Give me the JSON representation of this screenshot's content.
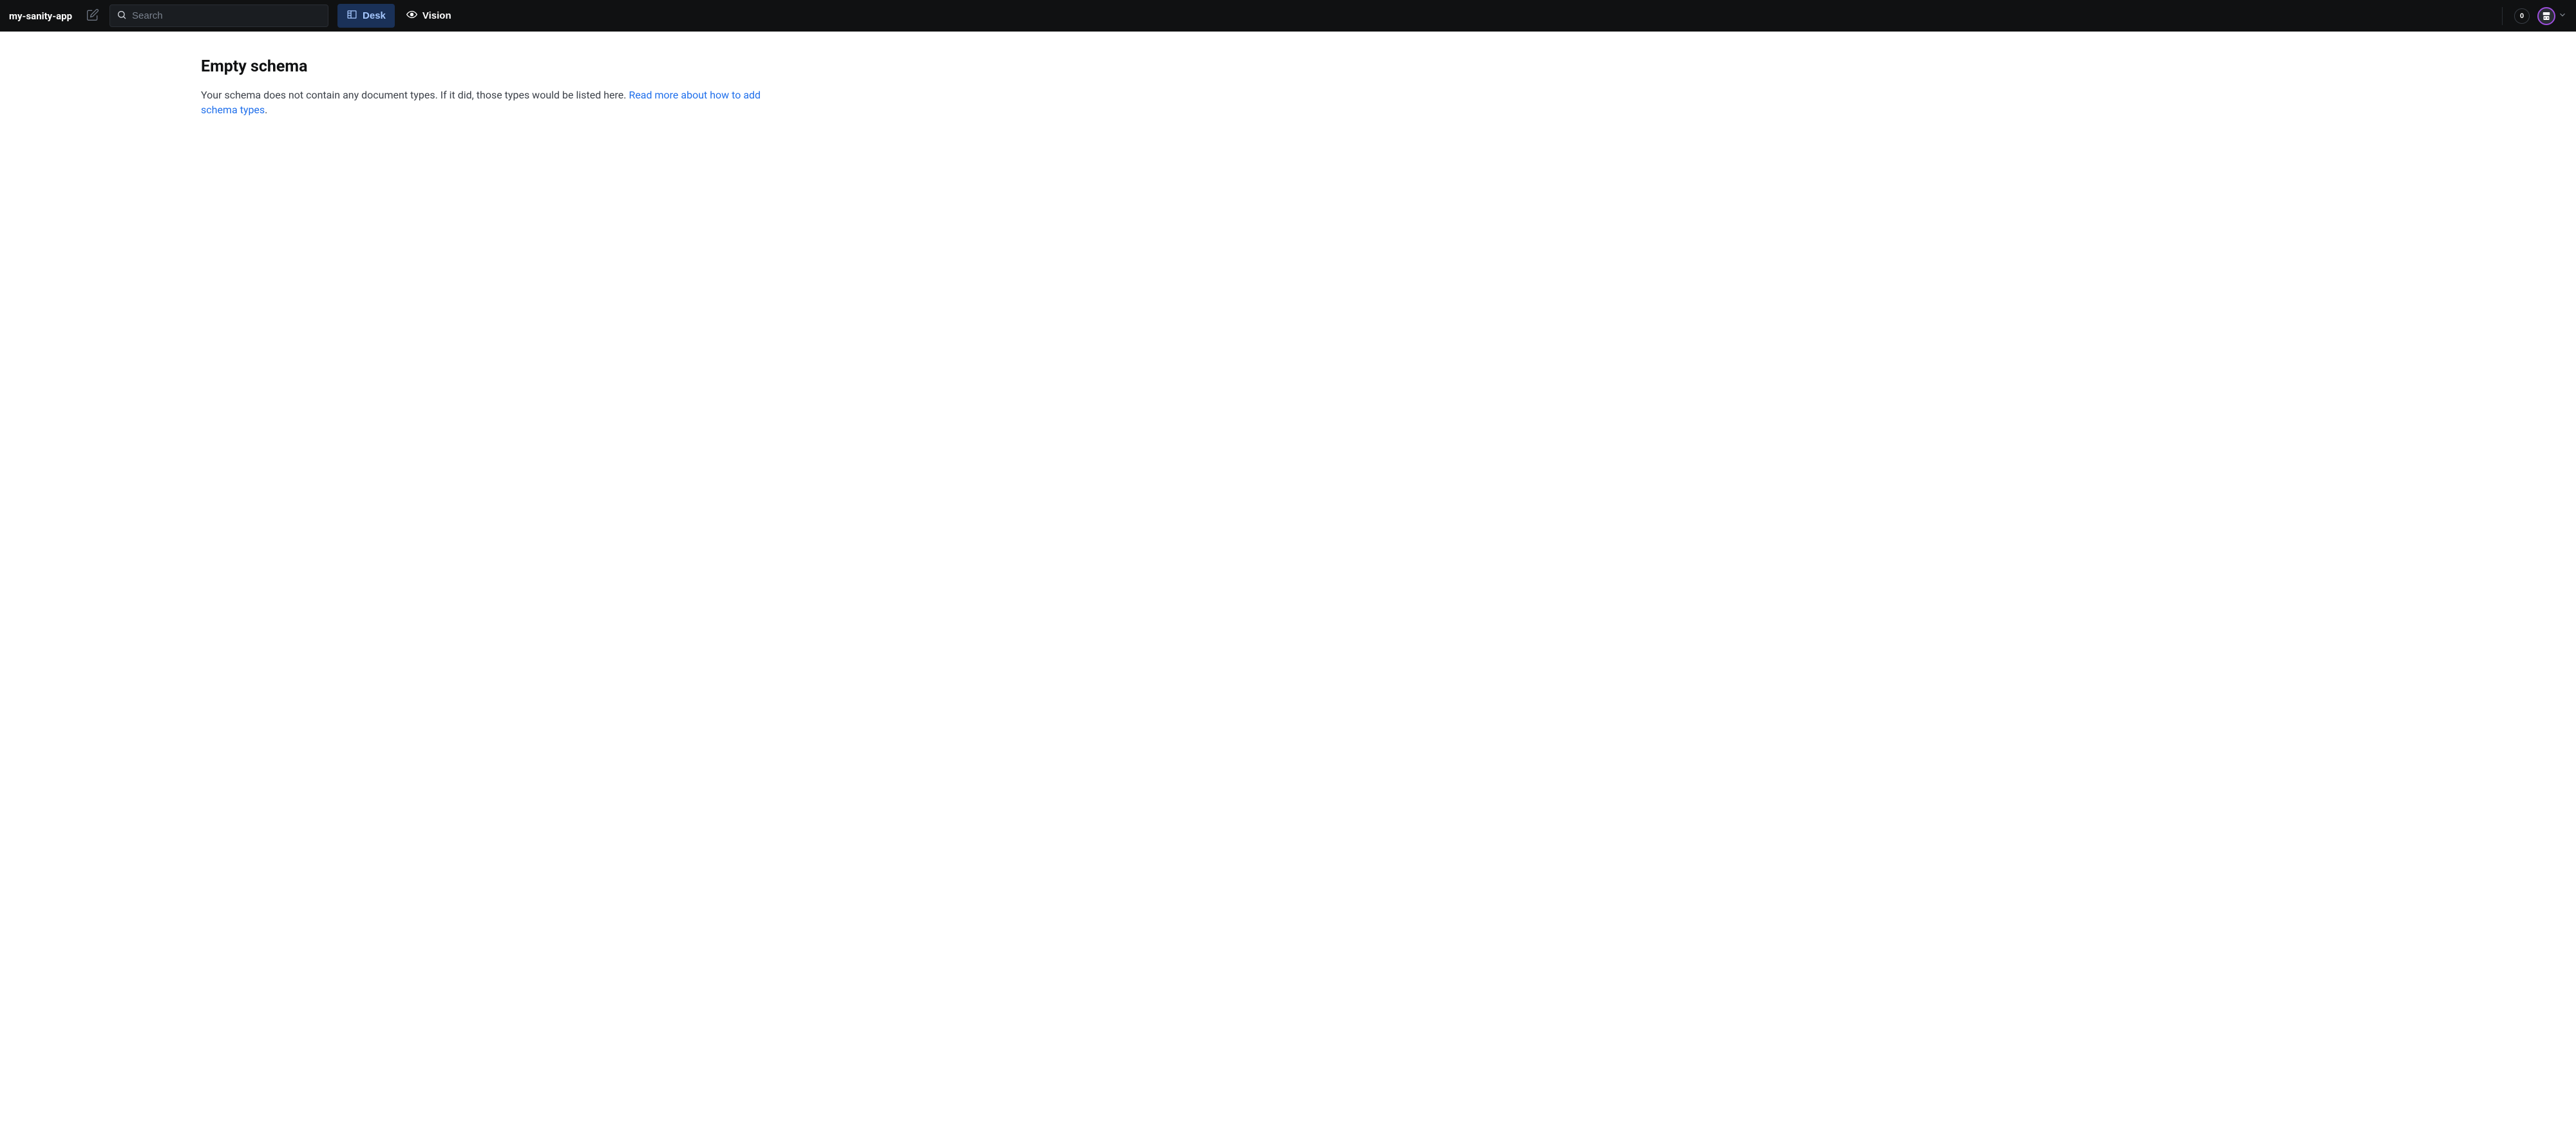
{
  "header": {
    "app_name": "my-sanity-app",
    "search_placeholder": "Search",
    "tabs": [
      {
        "label": "Desk",
        "active": true
      },
      {
        "label": "Vision",
        "active": false
      }
    ],
    "badge_count": "0"
  },
  "main": {
    "title": "Empty schema",
    "description_prefix": "Your schema does not contain any document types. If it did, those types would be listed here. ",
    "link_text": "Read more about how to add schema types",
    "description_suffix": "."
  }
}
